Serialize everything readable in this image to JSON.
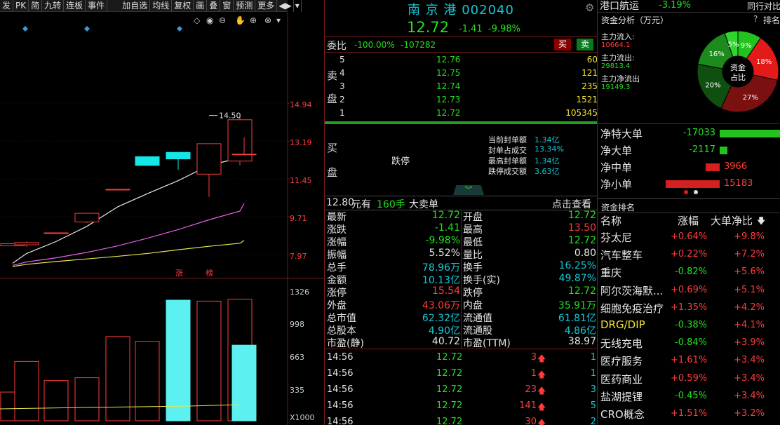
{
  "toolbar": [
    "发",
    "PK",
    "简",
    "九转",
    "连板",
    "事件",
    "加自选",
    "均线",
    "复权",
    "画",
    "叠",
    "窗",
    "预测",
    "更多"
  ],
  "chart": {
    "price_ticks": [
      "14.94",
      "13.19",
      "11.45",
      "9.71",
      "7.97"
    ],
    "high_label": "14.50",
    "limit_marks": [
      "涨",
      "榜"
    ],
    "vol_ticks": [
      "1326",
      "998",
      "663",
      "335",
      "X1000"
    ],
    "candles": [
      {
        "o": 8.5,
        "c": 8.6,
        "h": 8.6,
        "l": 8.5
      },
      {
        "o": 8.55,
        "c": 8.65,
        "h": 8.7,
        "l": 8.45
      },
      {
        "o": 9.1,
        "c": 9.1,
        "h": 9.1,
        "l": 9.1
      },
      {
        "o": 9.6,
        "c": 10.0,
        "h": 10.0,
        "l": 9.55
      },
      {
        "o": 11.1,
        "c": 11.1,
        "h": 11.1,
        "l": 11.1
      },
      {
        "o": 12.2,
        "c": 12.6,
        "h": 12.6,
        "l": 12.2
      },
      {
        "o": 12.8,
        "c": 12.5,
        "h": 12.8,
        "l": 12.0
      },
      {
        "o": 11.8,
        "c": 13.2,
        "h": 13.2,
        "l": 10.75
      },
      {
        "o": 12.4,
        "c": 14.3,
        "h": 14.5,
        "l": 12.2
      },
      {
        "o": 12.72,
        "c": 12.72,
        "h": 13.5,
        "l": 12.72
      }
    ],
    "vol": [
      300,
      620,
      420,
      450,
      880,
      830,
      1260,
      1250,
      1270,
      790
    ],
    "ma5": [
      7.7,
      8.15,
      8.7,
      9.4,
      10.3,
      10.9,
      11.5,
      12.2,
      12.55,
      12.74
    ],
    "ma10": [
      7.6,
      7.76,
      7.95,
      8.2,
      8.5,
      8.85,
      9.25,
      9.7,
      10.1,
      10.45
    ],
    "ma20": [
      7.55,
      7.65,
      7.78,
      7.9,
      8.02,
      8.15,
      8.32,
      8.48,
      8.62,
      8.75
    ]
  },
  "header": {
    "title": "南 京 港 002040",
    "price": "12.72",
    "change": "-1.41",
    "pct": "-9.98%"
  },
  "orderbook": {
    "weibi_label": "委比",
    "weibi_pct": "-100.00%",
    "weibi_val": "-107282",
    "sell_btn": "买",
    "buy_btn": "卖",
    "sell_label": [
      "卖",
      "盘"
    ],
    "buy_label": [
      "买",
      "盘"
    ],
    "sells": [
      [
        "5",
        "12.76",
        "60"
      ],
      [
        "4",
        "12.75",
        "121"
      ],
      [
        "3",
        "12.74",
        "235"
      ],
      [
        "2",
        "12.73",
        "1521"
      ],
      [
        "1",
        "12.72",
        "105345"
      ]
    ],
    "limit_text": "跌停",
    "seal": [
      [
        "当前封单额",
        "1.34亿"
      ],
      [
        "封单占成交",
        "13.34%"
      ],
      [
        "最高封单额",
        "1.34亿"
      ],
      [
        "跌停成交额",
        "3.63亿"
      ]
    ]
  },
  "bigorder": {
    "price": "12.80",
    "yuan": "元有",
    "qty": "160手",
    "label": "大卖单",
    "link": "点击查看"
  },
  "quote": [
    [
      "最新",
      "12.72",
      "开盘",
      "12.72"
    ],
    [
      "涨跌",
      "-1.41",
      "最高",
      "13.50"
    ],
    [
      "涨幅",
      "-9.98%",
      "最低",
      "12.72"
    ],
    [
      "振幅",
      "5.52%",
      "量比",
      "0.80"
    ],
    [
      "总手",
      "78.96万",
      "换手",
      "16.25%"
    ],
    [
      "金额",
      "10.13亿",
      "换手(实)",
      "49.87%"
    ],
    [
      "涨停",
      "15.54",
      "跌停",
      "12.72"
    ],
    [
      "外盘",
      "43.06万",
      "内盘",
      "35.91万"
    ],
    [
      "总市值",
      "62.32亿",
      "流通值",
      "61.81亿"
    ],
    [
      "总股本",
      "4.90亿",
      "流通股",
      "4.86亿"
    ],
    [
      "市盈(静)",
      "40.72",
      "市盈(TTM)",
      "38.97"
    ]
  ],
  "trades": [
    [
      "14:56",
      "12.72",
      "3",
      "1"
    ],
    [
      "14:56",
      "12.72",
      "1",
      "1"
    ],
    [
      "14:56",
      "12.72",
      "23",
      "3"
    ],
    [
      "14:56",
      "12.72",
      "141",
      "5"
    ],
    [
      "14:56",
      "12.72",
      "30",
      "2"
    ]
  ],
  "right": {
    "top_name": "港口航运",
    "top_pct": "-3.19%",
    "top_cmp": "同行对比",
    "fund_title": "资金分析（万元）",
    "fund_help": "?",
    "fund_rank": "排名",
    "inflow_label": "主力流入:",
    "inflow": "10664.1",
    "outflow_label": "主力流出:",
    "outflow": "29813.4",
    "net_label": "主力净流出",
    "net": "19149.3",
    "donut_center": [
      "资金",
      "占比"
    ],
    "donut": [
      {
        "label": "9%",
        "pct": 9,
        "color": "#23c21e"
      },
      {
        "label": "18%",
        "pct": 18,
        "color": "#e31a1a"
      },
      {
        "label": "27%",
        "pct": 27,
        "color": "#7a1010"
      },
      {
        "label": "20%",
        "pct": 20,
        "color": "#0f4f0f"
      },
      {
        "label": "16%",
        "pct": 16,
        "color": "#1c8a1c"
      },
      {
        "label": "5%",
        "pct": 5,
        "color": "#2fd42f"
      }
    ],
    "flows": [
      [
        "净特大单",
        "-17033",
        "#23c21e",
        -17033
      ],
      [
        "净大单",
        "-2117",
        "#23c21e",
        -2117
      ],
      [
        "净中单",
        "3966",
        "#d42020",
        3966
      ],
      [
        "净小单",
        "15183",
        "#d42020",
        15183
      ]
    ],
    "rank_title": "资金排名",
    "rank_headers": [
      "名称",
      "涨幅",
      "大单净比"
    ],
    "ranks": [
      [
        "芬太尼",
        "+0.64%",
        "+9.8%"
      ],
      [
        "汽车整车",
        "+0.22%",
        "+7.2%"
      ],
      [
        "重庆",
        "-0.82%",
        "+5.6%"
      ],
      [
        "阿尔茨海默...",
        "+0.69%",
        "+5.1%"
      ],
      [
        "细胞免疫治疗",
        "+1.35%",
        "+4.2%"
      ],
      [
        "DRG/DIP",
        "-0.38%",
        "+4.1%"
      ],
      [
        "无线充电",
        "-0.84%",
        "+3.9%"
      ],
      [
        "医疗服务",
        "+1.61%",
        "+3.4%"
      ],
      [
        "医药商业",
        "+0.59%",
        "+3.4%"
      ],
      [
        "盐湖提锂",
        "-0.45%",
        "+3.4%"
      ],
      [
        "CRO概念",
        "+1.51%",
        "+3.2%"
      ]
    ]
  }
}
